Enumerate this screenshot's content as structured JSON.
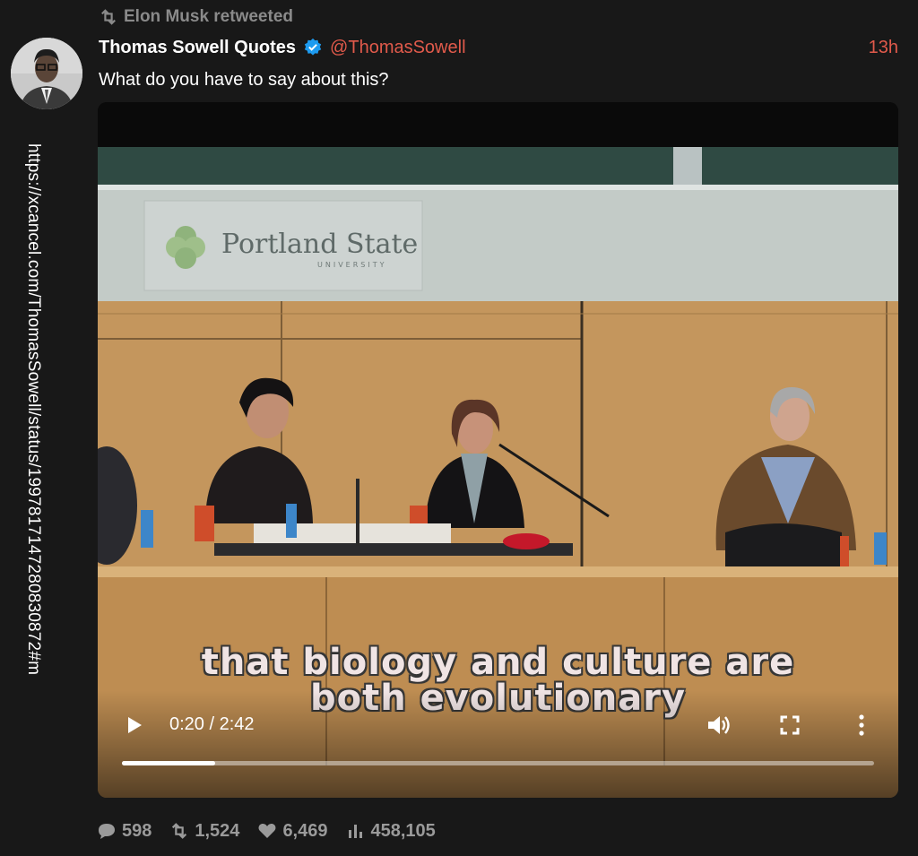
{
  "retweet": {
    "text": "Elon Musk retweeted",
    "icon": "retweet-icon"
  },
  "sidebar_url": "https://xcancel.com/ThomasSowell/status/1997817147280830872#m",
  "tweet": {
    "author_name": "Thomas Sowell Quotes",
    "verified_icon": "verified-badge-icon",
    "handle": "@ThomasSowell",
    "time": "13h",
    "text": "What do you have to say about this?"
  },
  "video": {
    "sign_text": "Portland State",
    "sign_subtext": "UNIVERSITY",
    "caption_line1": "that biology and culture are",
    "caption_line2": "both evolutionary",
    "current_time": "0:20",
    "duration": "2:42",
    "time_readout": "0:20 / 2:42",
    "progress_fraction": 0.1235
  },
  "stats": {
    "replies": "598",
    "retweets": "1,524",
    "likes": "6,469",
    "views": "458,105"
  },
  "colors": {
    "background": "#181818",
    "accent": "#e15a4b",
    "muted": "#8a8a8a",
    "verified": "#1d9bf0"
  }
}
